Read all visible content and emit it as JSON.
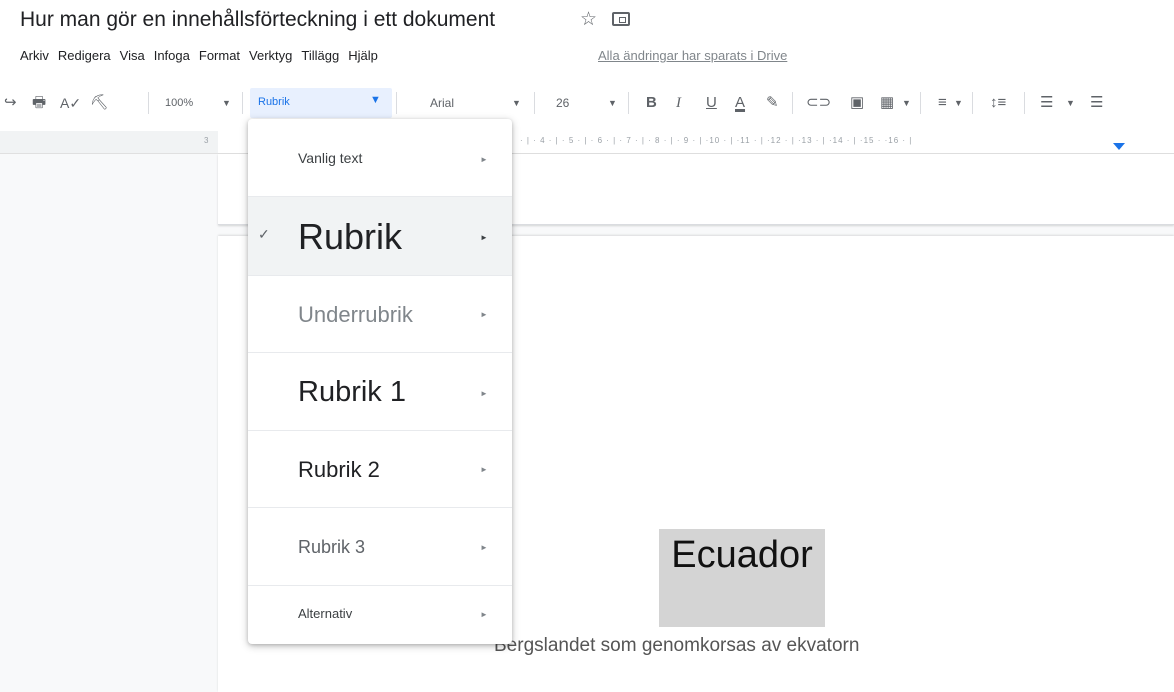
{
  "doc": {
    "title": "Hur man gör en innehållsförteckning i ett dokument",
    "star_icon": "☆",
    "save_status": "Alla ändringar har sparats i Drive"
  },
  "menubar": [
    "Arkiv",
    "Redigera",
    "Visa",
    "Infoga",
    "Format",
    "Verktyg",
    "Tillägg",
    "Hjälp"
  ],
  "toolbar": {
    "zoom": "100%",
    "style": "Rubrik",
    "font": "Arial",
    "font_size": "26",
    "bold": "B",
    "italic": "I",
    "underline": "U",
    "text_color": "A"
  },
  "ruler": {
    "left_mark": "3",
    "ticks": "· | · 4 · | · 5 · | · 6 · | · 7 · | · 8 · | · 9 · | ·10 · | ·11 · | ·12 · | ·13 · | ·14 · | ·15 · ·16 · |"
  },
  "style_menu": {
    "items": [
      {
        "label": "Vanlig text",
        "selected": false
      },
      {
        "label": "Rubrik",
        "selected": true
      },
      {
        "label": "Underrubrik",
        "selected": false
      },
      {
        "label": "Rubrik 1",
        "selected": false
      },
      {
        "label": "Rubrik 2",
        "selected": false
      },
      {
        "label": "Rubrik 3",
        "selected": false
      },
      {
        "label": "Alternativ",
        "selected": false
      }
    ],
    "check_icon": "✓",
    "arrow_icon": "►"
  },
  "document": {
    "heading": "Ecuador",
    "subtitle": "Bergslandet som genomkorsas av ekvatorn"
  },
  "colors": {
    "accent": "#1a73e8",
    "selection_highlight": "#d4d4d4"
  }
}
